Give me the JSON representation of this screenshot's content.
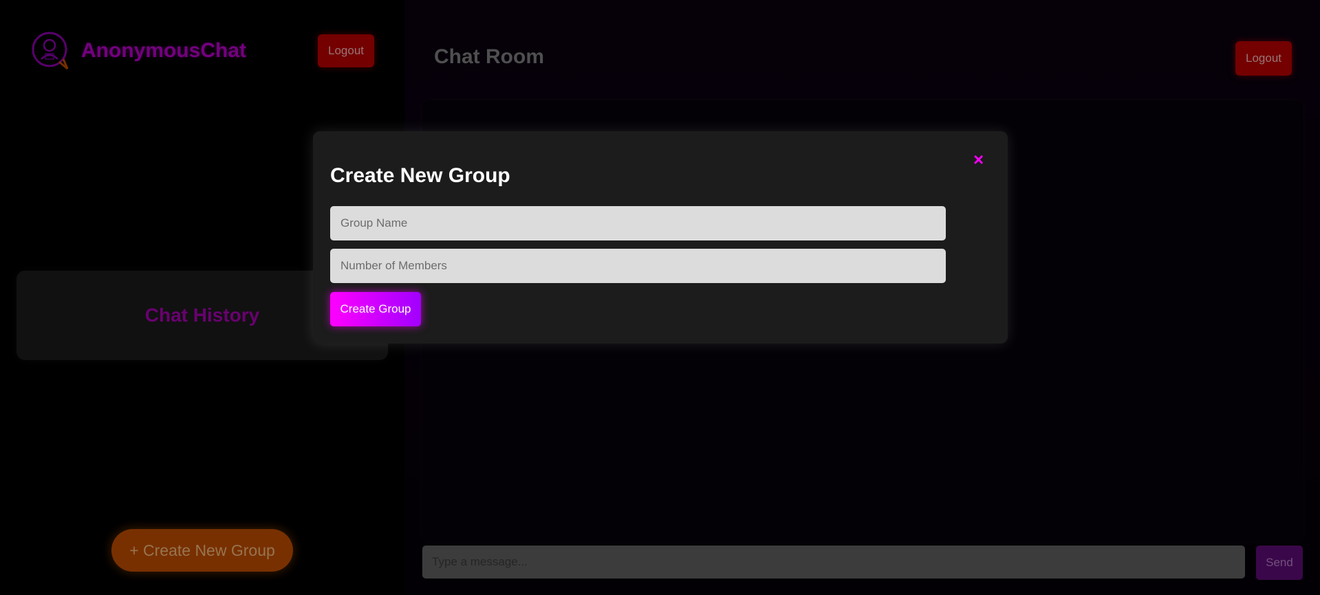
{
  "sidebar": {
    "brand_name": "AnonymousChat",
    "logout_label": "Logout",
    "history_title": "Chat History",
    "create_new_group_label": "+ Create New Group"
  },
  "main": {
    "room_title": "Chat Room",
    "logout_label": "Logout",
    "message_placeholder": "Type a message...",
    "send_label": "Send"
  },
  "modal": {
    "title": "Create New Group",
    "close_glyph": "×",
    "group_name_placeholder": "Group Name",
    "member_count_placeholder": "Number of Members",
    "create_label": "Create Group"
  },
  "colors": {
    "brand": "#b300c4",
    "accent": "#ff00ff",
    "logout": "#b30000",
    "create_new": "#b84a00"
  },
  "icons": {
    "brand_logo": "anonymous-chat-logo-icon",
    "close": "close-icon"
  }
}
